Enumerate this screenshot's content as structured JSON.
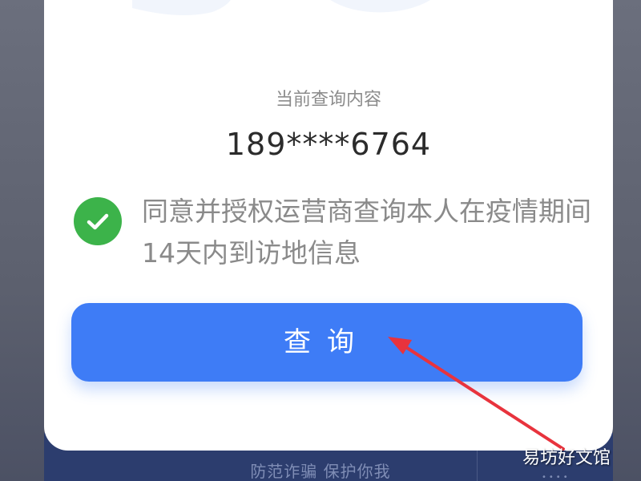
{
  "form": {
    "query_label": "当前查询内容",
    "query_value": "189****6764",
    "consent_text": "同意并授权运营商查询本人在疫情期间14天内到访地信息",
    "consent_checked": true,
    "check_icon": "checkmark-icon",
    "check_color": "#3cb34a"
  },
  "query_button": {
    "label": "查询",
    "color": "#3e7cf6"
  },
  "footer": {
    "slogan": "防范诈骗 保护你我",
    "dots": "••••"
  },
  "annotation": {
    "arrow_color": "#e8333d"
  },
  "watermark": {
    "text": "易坊好文馆"
  }
}
